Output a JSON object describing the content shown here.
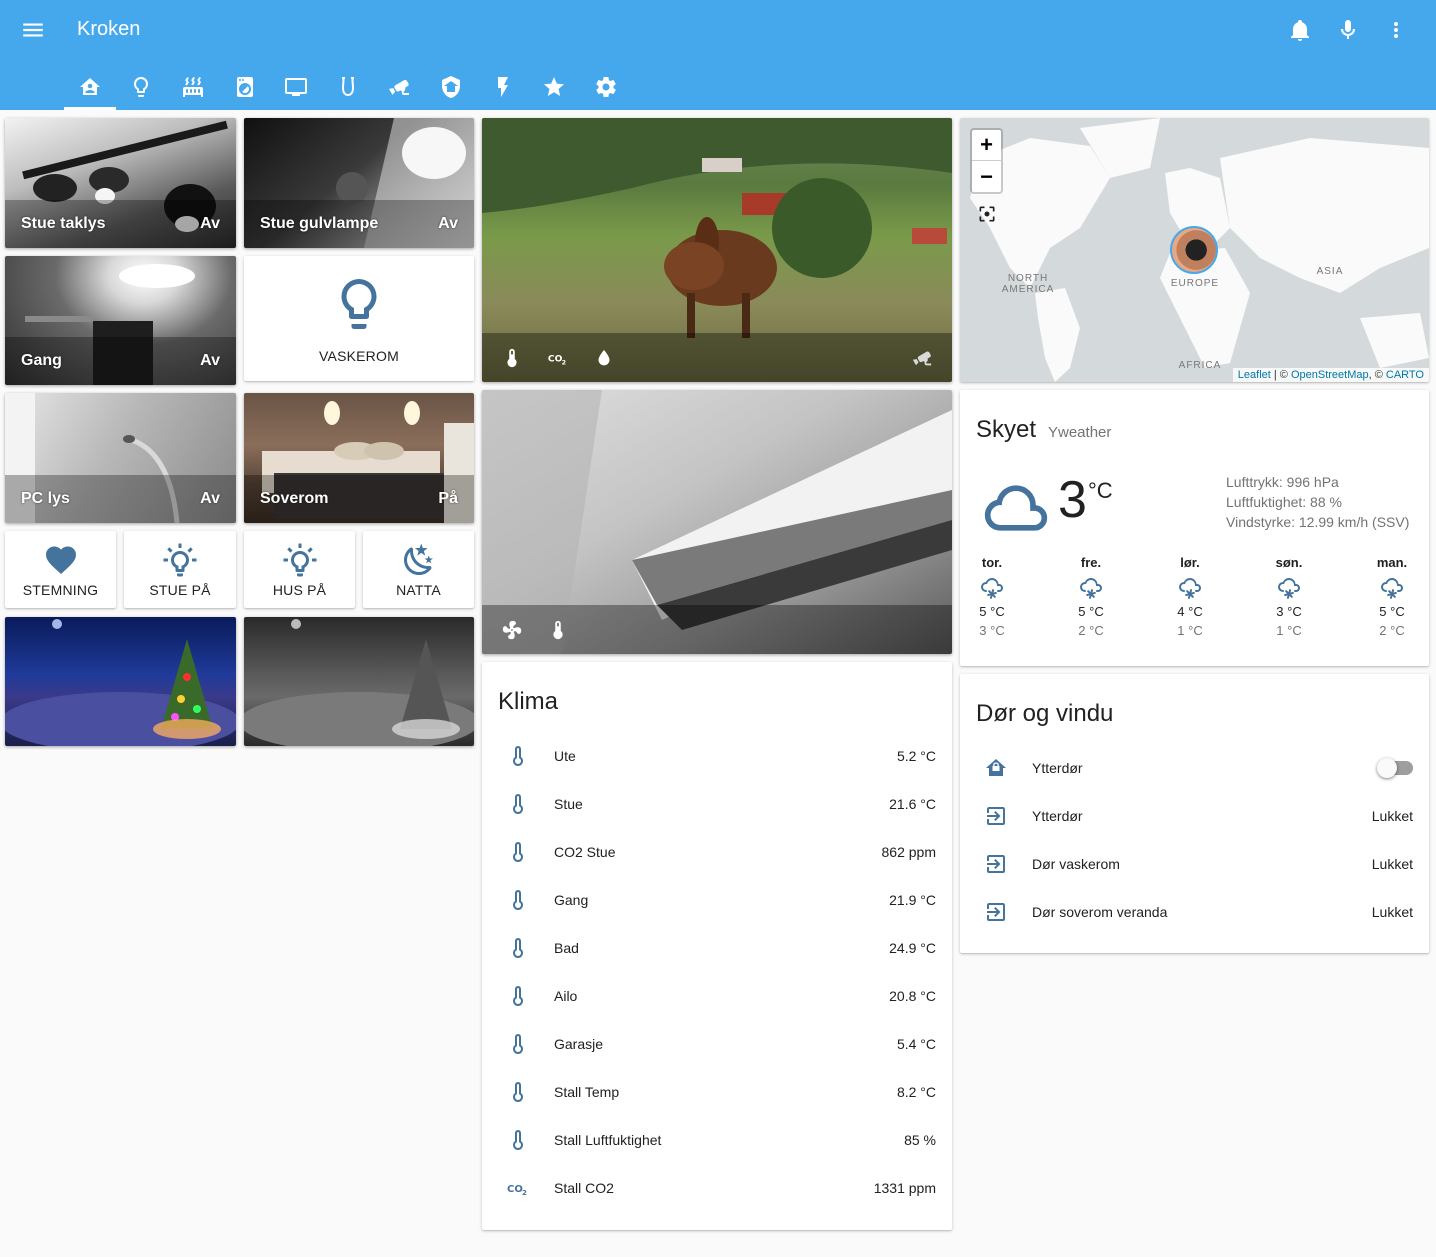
{
  "app": {
    "title": "Kroken",
    "header_color": "#46a8ec",
    "icon_color": "#44739e",
    "header_actions": [
      "notifications-icon",
      "microphone-icon",
      "overflow-menu-icon"
    ],
    "tabs": [
      {
        "name": "home-automation",
        "active": true
      },
      {
        "name": "lightbulb"
      },
      {
        "name": "radiator"
      },
      {
        "name": "washing-machine"
      },
      {
        "name": "television"
      },
      {
        "name": "horseshoe"
      },
      {
        "name": "cctv"
      },
      {
        "name": "security"
      },
      {
        "name": "flash"
      },
      {
        "name": "star"
      },
      {
        "name": "settings"
      }
    ]
  },
  "lights": {
    "stue_taklys": {
      "name": "Stue taklys",
      "state": "Av"
    },
    "stue_gulvlampe": {
      "name": "Stue gulvlampe",
      "state": "Av"
    },
    "gang": {
      "name": "Gang",
      "state": "Av"
    },
    "vaskerom": {
      "name": "VASKEROM"
    },
    "pc_lys": {
      "name": "PC lys",
      "state": "Av"
    },
    "soverom": {
      "name": "Soverom",
      "state": "På"
    }
  },
  "scenes": [
    {
      "label": "STEMNING",
      "icon": "heart-icon"
    },
    {
      "label": "STUE PÅ",
      "icon": "lightbulb-on-icon"
    },
    {
      "label": "HUS PÅ",
      "icon": "lightbulb-on-icon"
    },
    {
      "label": "NATTA",
      "icon": "weather-night-icon"
    }
  ],
  "klima": {
    "title": "Klima",
    "rows": [
      {
        "name": "Ute",
        "value": "5.2 °C",
        "icon": "thermometer"
      },
      {
        "name": "Stue",
        "value": "21.6 °C",
        "icon": "thermometer"
      },
      {
        "name": "CO2 Stue",
        "value": "862 ppm",
        "icon": "thermometer"
      },
      {
        "name": "Gang",
        "value": "21.9 °C",
        "icon": "thermometer"
      },
      {
        "name": "Bad",
        "value": "24.9 °C",
        "icon": "thermometer"
      },
      {
        "name": "Ailo",
        "value": "20.8 °C",
        "icon": "thermometer"
      },
      {
        "name": "Garasje",
        "value": "5.4 °C",
        "icon": "thermometer"
      },
      {
        "name": "Stall Temp",
        "value": "8.2 °C",
        "icon": "thermometer"
      },
      {
        "name": "Stall Luftfuktighet",
        "value": "85 %",
        "icon": "thermometer"
      },
      {
        "name": "Stall CO2",
        "value": "1331 ppm",
        "icon": "co2"
      }
    ]
  },
  "map": {
    "zoom_in": "+",
    "zoom_out": "−",
    "labels": {
      "north_america": "NORTH AMERICA",
      "europe": "EUROPE",
      "asia": "ASIA",
      "africa": "AFRICA"
    },
    "attribution": {
      "leaflet": "Leaflet",
      "sep1": " | © ",
      "osm": "OpenStreetMap",
      "sep2": ", © ",
      "carto": "CARTO"
    }
  },
  "weather": {
    "condition": "Skyet",
    "source": "Yweather",
    "temperature": "3",
    "unit": "°C",
    "pressure": "Lufttrykk: 996 hPa",
    "humidity": "Luftfuktighet: 88 %",
    "wind": "Vindstyrke: 12.99 km/h (SSV)",
    "forecast": [
      {
        "day": "tor.",
        "high": "5 °C",
        "low": "3 °C"
      },
      {
        "day": "fre.",
        "high": "5 °C",
        "low": "2 °C"
      },
      {
        "day": "lør.",
        "high": "4 °C",
        "low": "1 °C"
      },
      {
        "day": "søn.",
        "high": "3 °C",
        "low": "1 °C"
      },
      {
        "day": "man.",
        "high": "5 °C",
        "low": "2 °C"
      }
    ]
  },
  "doors": {
    "title": "Dør og vindu",
    "rows": [
      {
        "name": "Ytterdør",
        "type": "toggle",
        "on": false,
        "icon": "home-lock"
      },
      {
        "name": "Ytterdør",
        "value": "Lukket",
        "icon": "login"
      },
      {
        "name": "Dør vaskerom",
        "value": "Lukket",
        "icon": "login"
      },
      {
        "name": "Dør soverom veranda",
        "value": "Lukket",
        "icon": "login"
      }
    ]
  }
}
